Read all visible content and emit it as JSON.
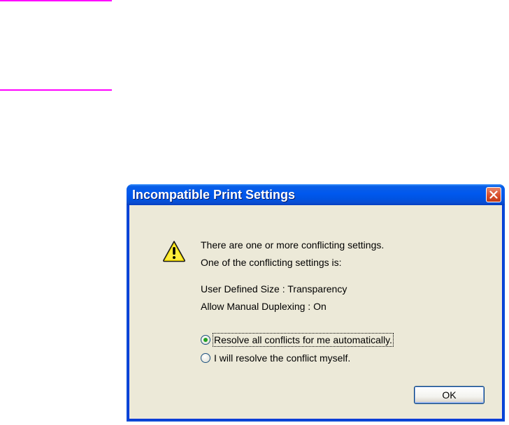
{
  "dialog": {
    "title": "Incompatible Print Settings",
    "close_icon": "close-icon",
    "icon": "warning-icon",
    "message_line_1": "There are one or more conflicting settings.",
    "message_line_2": "One of the conflicting settings is:",
    "conflict_1": "User Defined Size : Transparency",
    "conflict_2": "Allow Manual Duplexing : On",
    "options": [
      {
        "label": "Resolve all conflicts for me automatically.",
        "selected": true
      },
      {
        "label": "I will resolve the conflict myself.",
        "selected": false
      }
    ],
    "ok_label": "OK"
  },
  "colors": {
    "titlebar": "#0058ee",
    "dialog_bg": "#ece9d8",
    "decorative_rule": "#ff00ff",
    "close_button": "#d9502c",
    "radio_selected": "#21a121",
    "warning_icon": "#ffe600"
  }
}
